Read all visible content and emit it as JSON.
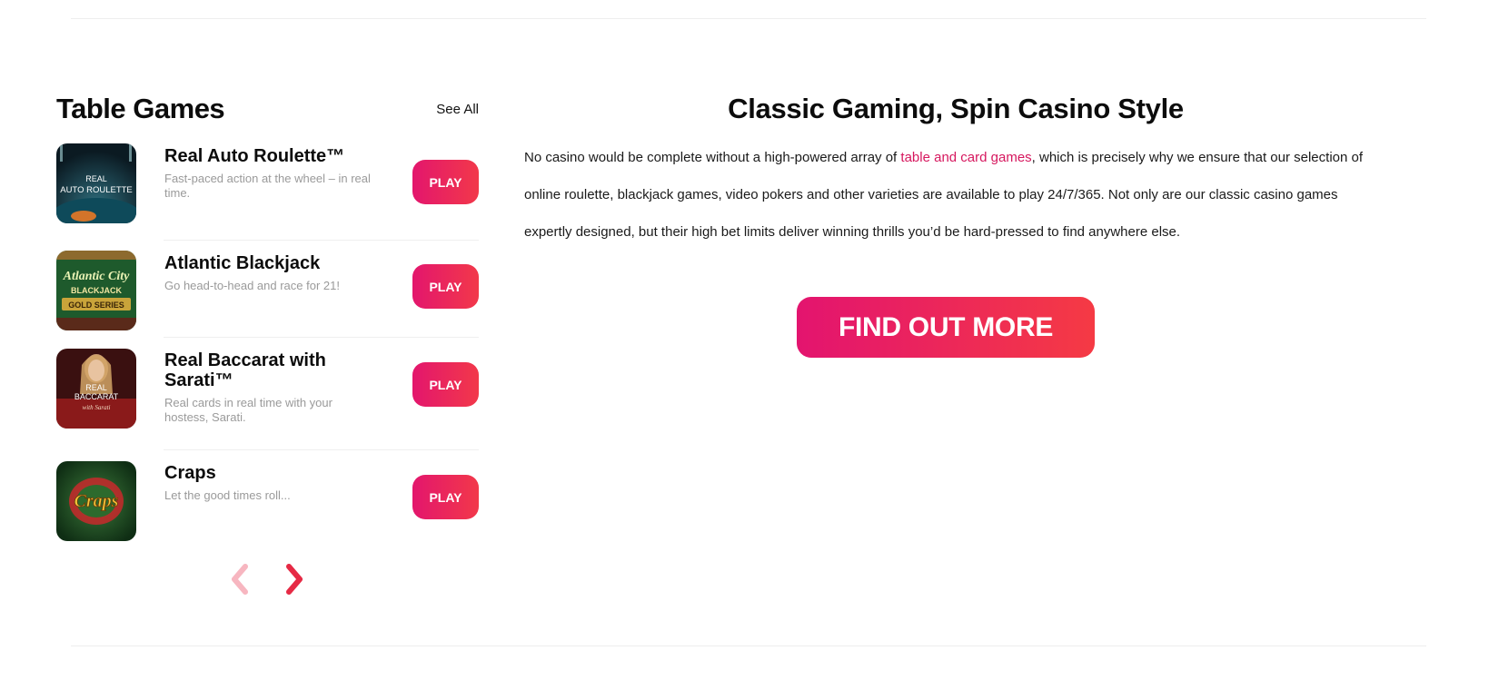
{
  "table_games": {
    "title": "Table Games",
    "see_all": "See All",
    "play_label": "PLAY",
    "items": [
      {
        "name": "Real Auto Roulette™",
        "description": "Fast-paced action at the wheel – in real time.",
        "thumb_text_1": "REAL",
        "thumb_text_2": "AUTO ROULETTE"
      },
      {
        "name": "Atlantic Blackjack",
        "description": "Go head-to-head and race for 21!",
        "thumb_text_1": "Atlantic City",
        "thumb_text_2": "BLACKJACK",
        "thumb_text_3": "GOLD SERIES"
      },
      {
        "name": "Real Baccarat with Sarati™",
        "description": "Real cards in real time with your hostess, Sarati.",
        "thumb_text_1": "REAL",
        "thumb_text_2": "BACCARAT",
        "thumb_text_3": "with Sarati"
      },
      {
        "name": "Craps",
        "description": "Let the good times roll...",
        "thumb_text_1": "Craps"
      }
    ],
    "pager": {
      "prev_icon": "chevron-left-icon",
      "next_icon": "chevron-right-icon"
    }
  },
  "content": {
    "title": "Classic Gaming, Spin Casino Style",
    "body_part_1": "No casino would be complete without a high-powered array of ",
    "body_link": "table and card games",
    "body_part_2": ", which is precisely why we ensure that our selection of online roulette, blackjack games, video pokers and other varieties are available to play 24/7/365. Not only are our classic casino games expertly designed, but their high bet limits deliver winning thrills you’d be hard-pressed to find anywhere else.",
    "button": "FIND OUT MORE"
  },
  "colors": {
    "accent_start": "#e3166d",
    "accent_end": "#f2384a",
    "link": "#d6175e"
  }
}
